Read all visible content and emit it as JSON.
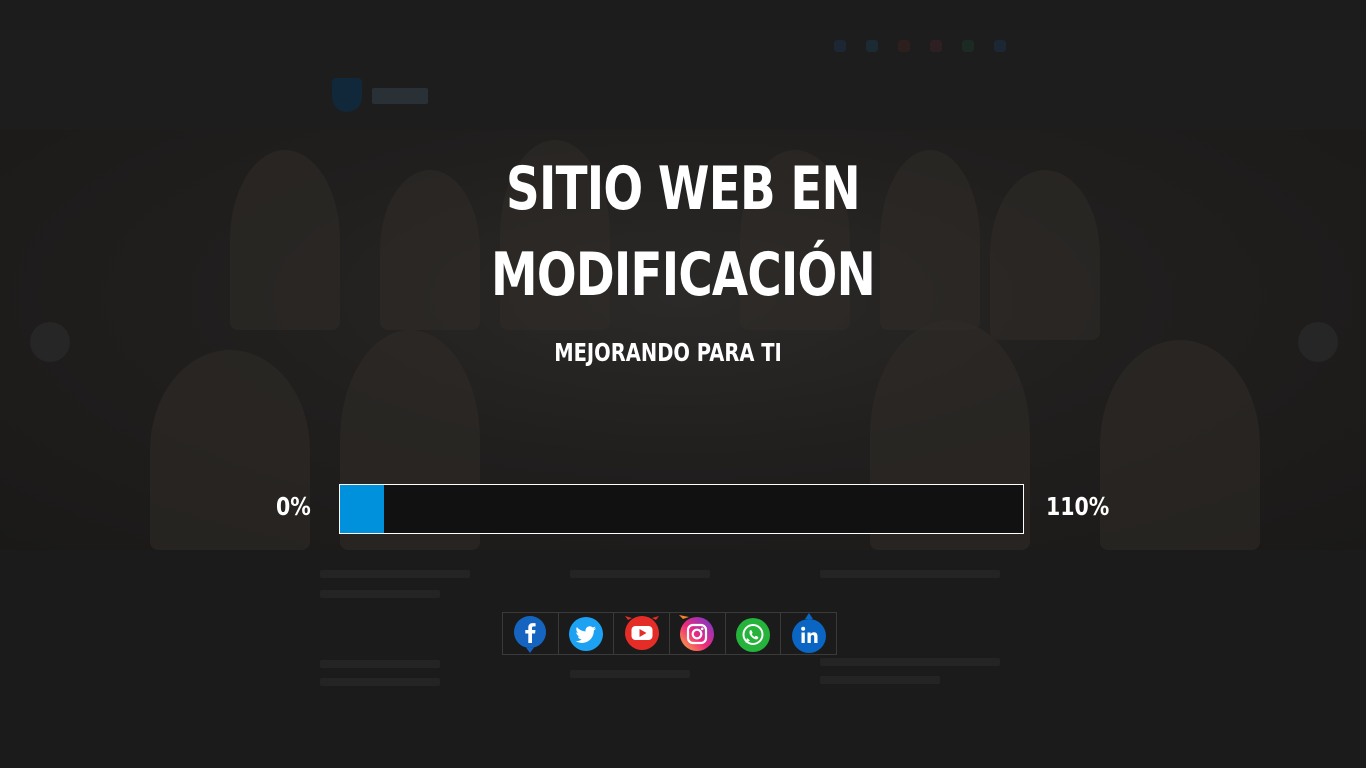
{
  "overlay": {
    "title_line1": "SITIO WEB EN",
    "title_line2": "MODIFICACIÓN",
    "subtitle": "MEJORANDO PARA TI"
  },
  "progress": {
    "min_label": "0%",
    "max_label": "110%",
    "fraction": 0.064,
    "color": "#0091dc"
  },
  "social": [
    {
      "name": "facebook",
      "icon": "facebook-icon",
      "color": "#1565c0"
    },
    {
      "name": "twitter",
      "icon": "twitter-icon",
      "color": "#1da1f2"
    },
    {
      "name": "youtube",
      "icon": "youtube-icon",
      "color": "#e52d27"
    },
    {
      "name": "instagram",
      "icon": "instagram-icon",
      "color": "#d6249f"
    },
    {
      "name": "whatsapp",
      "icon": "whatsapp-icon",
      "color": "#25b33b"
    },
    {
      "name": "linkedin",
      "icon": "linkedin-icon",
      "color": "#0a66c2"
    }
  ]
}
